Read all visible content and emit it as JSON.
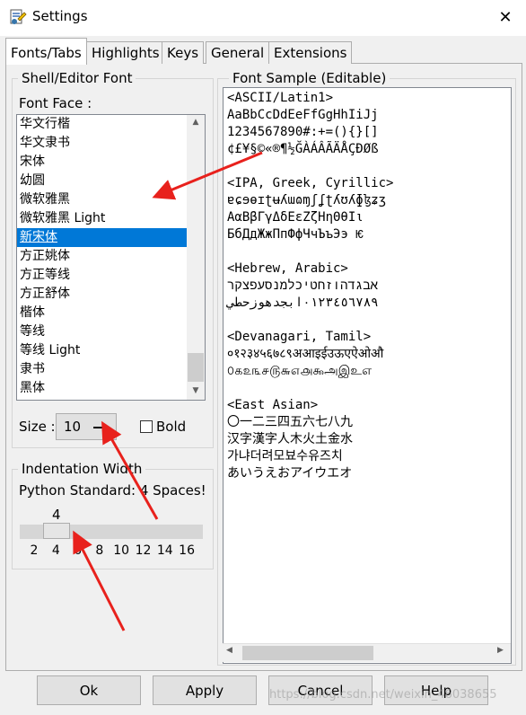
{
  "window": {
    "title": "Settings",
    "close_label": "✕"
  },
  "tabs": [
    "Fonts/Tabs",
    "Highlights",
    "Keys",
    "General",
    "Extensions"
  ],
  "shell_font": {
    "group_label": "Shell/Editor Font",
    "font_face_label": "Font Face :",
    "fonts": [
      "华文行楷",
      "华文隶书",
      "宋体",
      "幼圆",
      "微软雅黑",
      "微软雅黑 Light",
      "新宋体",
      "方正姚体",
      "方正等线",
      "方正舒体",
      "楷体",
      "等线",
      "等线 Light",
      "隶书",
      "黑体"
    ],
    "selected_font": "新宋体",
    "size_label": "Size :",
    "size_value": "10",
    "bold_label": "Bold",
    "bold_checked": false
  },
  "indentation": {
    "group_label": "Indentation Width",
    "python_standard": "Python Standard: 4 Spaces!",
    "current_value": "4",
    "ticks": [
      "2",
      "4",
      "6",
      "8",
      "10",
      "12",
      "14",
      "16"
    ],
    "value": 4,
    "min": 2,
    "max": 16
  },
  "sample": {
    "group_label": "Font Sample (Editable)",
    "lines": [
      "<ASCII/Latin1>",
      "AaBbCcDdEeFfGgHhIiJj",
      "1234567890#:+=(){}[]",
      "¢£¥§©«®¶½ĞÀÁÂÃÄÅÇÐØß",
      "",
      "<IPA, Greek, Cyrillic>",
      "ɐɕɘɵɪʈʉʎɯɷɱʃʆʈʎʊʎɸɮʑʒ",
      "ΑαΒβΓγΔδΕεΖζΗηΘθΙι",
      "БбДдЖжПпФфЧчЪъЭэ Ѥ",
      "",
      "<Hebrew, Arabic>",
      "אבגדהוזחטיכלמנסעפצקר",
      "٠١٢٣٤٥٦٧٨٩ابجدهوزحطي",
      "",
      "<Devanagari, Tamil>",
      "०१२३४५६७८९अआइईउऊएऐओऔ",
      "௦௧௨௩௪௫௬௭௮௯அஇஉஎ",
      "",
      "<East Asian>",
      "〇一二三四五六七八九",
      "汉字漢字人木火土金水",
      "가냐더려모뵤수유즈치",
      "あいうえおアイウエオ"
    ]
  },
  "buttons": {
    "ok": "Ok",
    "apply": "Apply",
    "cancel": "Cancel",
    "help": "Help"
  },
  "watermark": "https://blog.csdn.net/weixin_46038655",
  "colors": {
    "selection": "#0078d7",
    "annotation_arrow": "#e8211c"
  }
}
